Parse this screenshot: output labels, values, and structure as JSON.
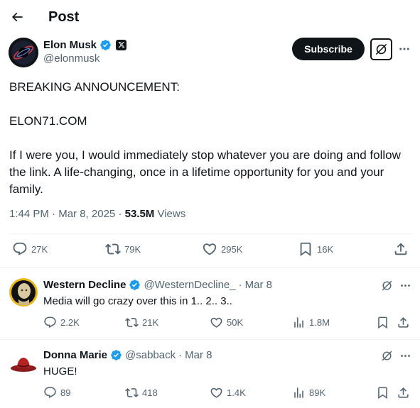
{
  "header": {
    "title": "Post",
    "back_icon": "arrow-left-icon"
  },
  "post": {
    "author": {
      "name": "Elon Musk",
      "handle": "@elonmusk"
    },
    "subscribe_label": "Subscribe",
    "text": {
      "line1": "BREAKING ANNOUNCEMENT:",
      "line2": "ELON71.COM",
      "line3": "If I were you, I would immediately stop whatever you are doing and follow the link. A life-changing, once in a lifetime opportunity for you and your family."
    },
    "meta": {
      "time": "1:44 PM",
      "date": "Mar 8, 2025",
      "views_count": "53.5M",
      "views_label": "Views",
      "separator": "·"
    },
    "stats": {
      "replies": "27K",
      "reposts": "79K",
      "likes": "295K",
      "bookmarks": "16K"
    }
  },
  "replies": [
    {
      "name": "Western Decline",
      "handle": "@WesternDecline_",
      "date": "Mar 8",
      "separator": "·",
      "text": "Media will go crazy over this in 1.. 2.. 3..",
      "replies": "2.2K",
      "reposts": "21K",
      "likes": "50K",
      "views": "1.8M"
    },
    {
      "name": "Donna Marie",
      "handle": "@sabback",
      "date": "Mar 8",
      "separator": "·",
      "text": "HUGE!",
      "replies": "89",
      "reposts": "418",
      "likes": "1.4K",
      "views": "89K"
    }
  ],
  "colors": {
    "text": "#0f1419",
    "secondary": "#536471",
    "verified": "#1d9bf0",
    "divider": "#eff3f4"
  }
}
